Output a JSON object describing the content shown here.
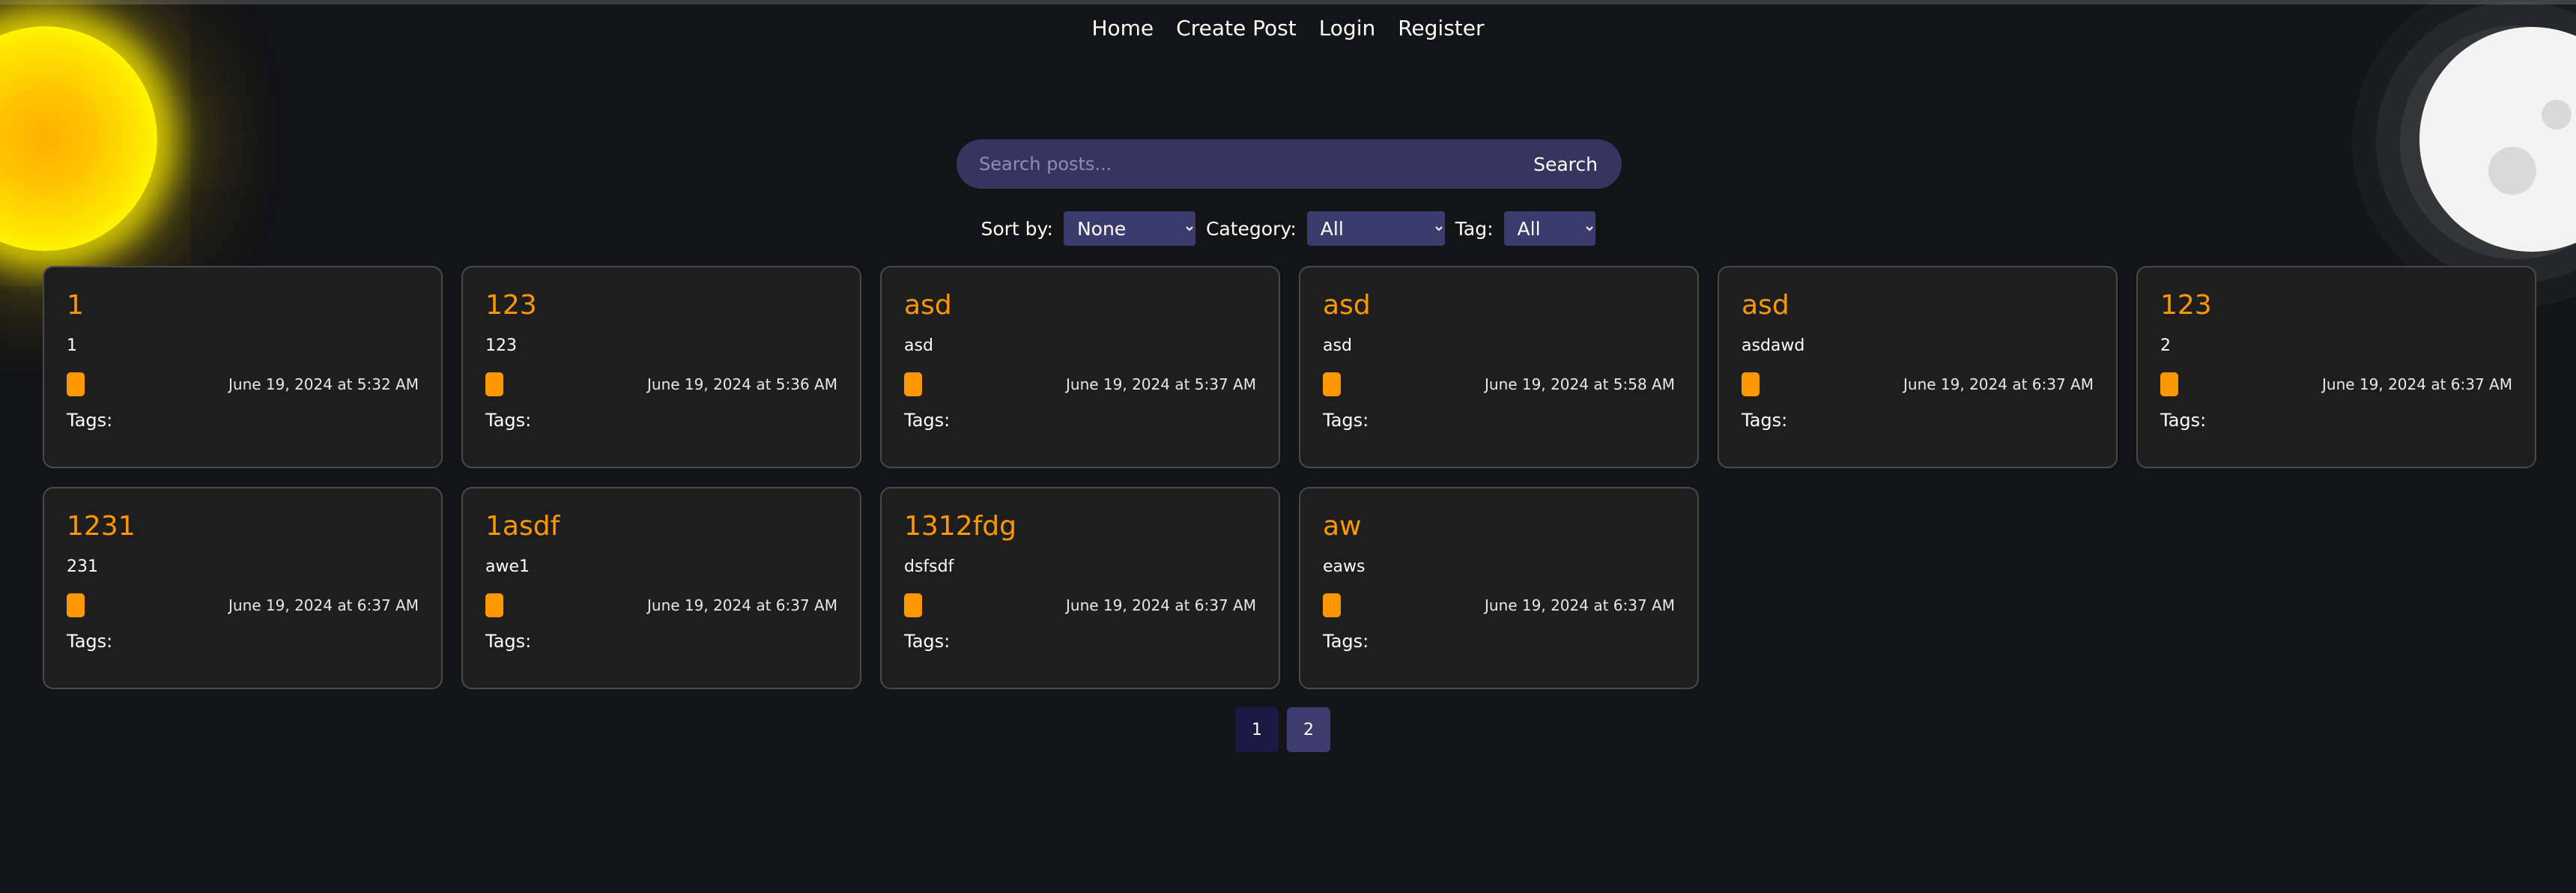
{
  "nav": {
    "items": [
      "Home",
      "Create Post",
      "Login",
      "Register"
    ]
  },
  "search": {
    "placeholder": "Search posts...",
    "button_label": "Search"
  },
  "filters": {
    "sort_label": "Sort by:",
    "sort_value": "None",
    "category_label": "Category:",
    "category_value": "All",
    "tag_label": "Tag:",
    "tag_value": "All"
  },
  "posts": [
    {
      "title": "1",
      "content": "1",
      "date": "June 19, 2024 at 5:32 AM",
      "tags_label": "Tags:"
    },
    {
      "title": "123",
      "content": "123",
      "date": "June 19, 2024 at 5:36 AM",
      "tags_label": "Tags:"
    },
    {
      "title": "asd",
      "content": "asd",
      "date": "June 19, 2024 at 5:37 AM",
      "tags_label": "Tags:"
    },
    {
      "title": "asd",
      "content": "asd",
      "date": "June 19, 2024 at 5:58 AM",
      "tags_label": "Tags:"
    },
    {
      "title": "asd",
      "content": "asdawd",
      "date": "June 19, 2024 at 6:37 AM",
      "tags_label": "Tags:"
    },
    {
      "title": "123",
      "content": "2",
      "date": "June 19, 2024 at 6:37 AM",
      "tags_label": "Tags:"
    },
    {
      "title": "1231",
      "content": "231",
      "date": "June 19, 2024 at 6:37 AM",
      "tags_label": "Tags:"
    },
    {
      "title": "1asdf",
      "content": "awe1",
      "date": "June 19, 2024 at 6:37 AM",
      "tags_label": "Tags:"
    },
    {
      "title": "1312fdg",
      "content": "dsfsdf",
      "date": "June 19, 2024 at 6:37 AM",
      "tags_label": "Tags:"
    },
    {
      "title": "aw",
      "content": "eaws",
      "date": "June 19, 2024 at 6:37 AM",
      "tags_label": "Tags:"
    }
  ],
  "pagination": {
    "pages": [
      "1",
      "2"
    ]
  },
  "colors": {
    "background": "#131416",
    "accent": "#ff9800",
    "card_background": "#1e1e1f",
    "search_background": "#35355f"
  },
  "icons": [
    "sun-icon",
    "moon-icon"
  ]
}
